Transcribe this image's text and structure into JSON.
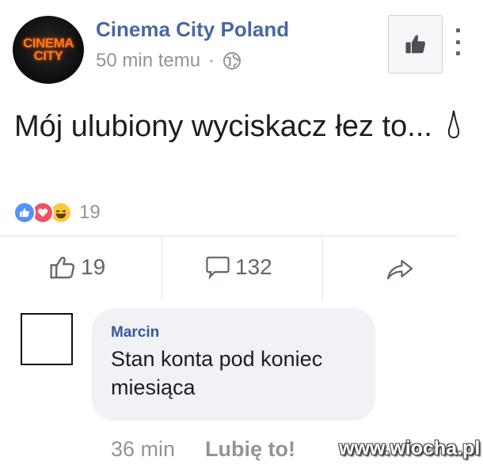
{
  "post": {
    "page_logo_text_line1": "CINEMA",
    "page_logo_text_line2": "CITY",
    "page_name": "Cinema City Poland",
    "timestamp": "50 min temu",
    "separator": "·",
    "privacy_icon": "globe-icon",
    "text": "Mój ulubiony wyciskacz łez to...",
    "reactions": [
      "like",
      "love",
      "haha"
    ],
    "reaction_count": "19"
  },
  "actions": {
    "like_count": "19",
    "comment_count": "132",
    "share_icon": "share-arrow-icon"
  },
  "comment": {
    "author": "Marcin",
    "text": "Stan konta pod koniec miesiąca",
    "time": "36 min",
    "like_label": "Lubię to!"
  },
  "watermark": "www.wiocha.pl",
  "colors": {
    "page_name": "#4b67a1",
    "muted": "#90949c",
    "comment_bg": "#f0f2f5",
    "like_blue": "#5890ff",
    "love_red": "#f25268",
    "haha_yellow": "#fcc93b"
  }
}
